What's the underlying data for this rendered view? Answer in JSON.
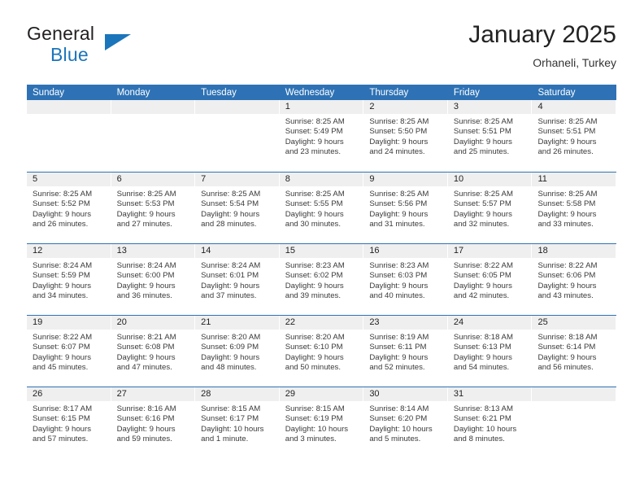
{
  "brand": {
    "name_top": "General",
    "name_bottom": "Blue",
    "logo_icon": "triangle-icon",
    "accent_color": "#1b75bb"
  },
  "header": {
    "title": "January 2025",
    "subtitle": "Orhaneli, Turkey"
  },
  "theme": {
    "header_bar_color": "#2e72b5",
    "day_band_color": "#efefef",
    "text_color": "#3a3a3a"
  },
  "calendar": {
    "weekdays": [
      "Sunday",
      "Monday",
      "Tuesday",
      "Wednesday",
      "Thursday",
      "Friday",
      "Saturday"
    ],
    "weeks": [
      [
        {
          "day": "",
          "lines": []
        },
        {
          "day": "",
          "lines": []
        },
        {
          "day": "",
          "lines": []
        },
        {
          "day": "1",
          "lines": [
            "Sunrise: 8:25 AM",
            "Sunset: 5:49 PM",
            "Daylight: 9 hours",
            "and 23 minutes."
          ]
        },
        {
          "day": "2",
          "lines": [
            "Sunrise: 8:25 AM",
            "Sunset: 5:50 PM",
            "Daylight: 9 hours",
            "and 24 minutes."
          ]
        },
        {
          "day": "3",
          "lines": [
            "Sunrise: 8:25 AM",
            "Sunset: 5:51 PM",
            "Daylight: 9 hours",
            "and 25 minutes."
          ]
        },
        {
          "day": "4",
          "lines": [
            "Sunrise: 8:25 AM",
            "Sunset: 5:51 PM",
            "Daylight: 9 hours",
            "and 26 minutes."
          ]
        }
      ],
      [
        {
          "day": "5",
          "lines": [
            "Sunrise: 8:25 AM",
            "Sunset: 5:52 PM",
            "Daylight: 9 hours",
            "and 26 minutes."
          ]
        },
        {
          "day": "6",
          "lines": [
            "Sunrise: 8:25 AM",
            "Sunset: 5:53 PM",
            "Daylight: 9 hours",
            "and 27 minutes."
          ]
        },
        {
          "day": "7",
          "lines": [
            "Sunrise: 8:25 AM",
            "Sunset: 5:54 PM",
            "Daylight: 9 hours",
            "and 28 minutes."
          ]
        },
        {
          "day": "8",
          "lines": [
            "Sunrise: 8:25 AM",
            "Sunset: 5:55 PM",
            "Daylight: 9 hours",
            "and 30 minutes."
          ]
        },
        {
          "day": "9",
          "lines": [
            "Sunrise: 8:25 AM",
            "Sunset: 5:56 PM",
            "Daylight: 9 hours",
            "and 31 minutes."
          ]
        },
        {
          "day": "10",
          "lines": [
            "Sunrise: 8:25 AM",
            "Sunset: 5:57 PM",
            "Daylight: 9 hours",
            "and 32 minutes."
          ]
        },
        {
          "day": "11",
          "lines": [
            "Sunrise: 8:25 AM",
            "Sunset: 5:58 PM",
            "Daylight: 9 hours",
            "and 33 minutes."
          ]
        }
      ],
      [
        {
          "day": "12",
          "lines": [
            "Sunrise: 8:24 AM",
            "Sunset: 5:59 PM",
            "Daylight: 9 hours",
            "and 34 minutes."
          ]
        },
        {
          "day": "13",
          "lines": [
            "Sunrise: 8:24 AM",
            "Sunset: 6:00 PM",
            "Daylight: 9 hours",
            "and 36 minutes."
          ]
        },
        {
          "day": "14",
          "lines": [
            "Sunrise: 8:24 AM",
            "Sunset: 6:01 PM",
            "Daylight: 9 hours",
            "and 37 minutes."
          ]
        },
        {
          "day": "15",
          "lines": [
            "Sunrise: 8:23 AM",
            "Sunset: 6:02 PM",
            "Daylight: 9 hours",
            "and 39 minutes."
          ]
        },
        {
          "day": "16",
          "lines": [
            "Sunrise: 8:23 AM",
            "Sunset: 6:03 PM",
            "Daylight: 9 hours",
            "and 40 minutes."
          ]
        },
        {
          "day": "17",
          "lines": [
            "Sunrise: 8:22 AM",
            "Sunset: 6:05 PM",
            "Daylight: 9 hours",
            "and 42 minutes."
          ]
        },
        {
          "day": "18",
          "lines": [
            "Sunrise: 8:22 AM",
            "Sunset: 6:06 PM",
            "Daylight: 9 hours",
            "and 43 minutes."
          ]
        }
      ],
      [
        {
          "day": "19",
          "lines": [
            "Sunrise: 8:22 AM",
            "Sunset: 6:07 PM",
            "Daylight: 9 hours",
            "and 45 minutes."
          ]
        },
        {
          "day": "20",
          "lines": [
            "Sunrise: 8:21 AM",
            "Sunset: 6:08 PM",
            "Daylight: 9 hours",
            "and 47 minutes."
          ]
        },
        {
          "day": "21",
          "lines": [
            "Sunrise: 8:20 AM",
            "Sunset: 6:09 PM",
            "Daylight: 9 hours",
            "and 48 minutes."
          ]
        },
        {
          "day": "22",
          "lines": [
            "Sunrise: 8:20 AM",
            "Sunset: 6:10 PM",
            "Daylight: 9 hours",
            "and 50 minutes."
          ]
        },
        {
          "day": "23",
          "lines": [
            "Sunrise: 8:19 AM",
            "Sunset: 6:11 PM",
            "Daylight: 9 hours",
            "and 52 minutes."
          ]
        },
        {
          "day": "24",
          "lines": [
            "Sunrise: 8:18 AM",
            "Sunset: 6:13 PM",
            "Daylight: 9 hours",
            "and 54 minutes."
          ]
        },
        {
          "day": "25",
          "lines": [
            "Sunrise: 8:18 AM",
            "Sunset: 6:14 PM",
            "Daylight: 9 hours",
            "and 56 minutes."
          ]
        }
      ],
      [
        {
          "day": "26",
          "lines": [
            "Sunrise: 8:17 AM",
            "Sunset: 6:15 PM",
            "Daylight: 9 hours",
            "and 57 minutes."
          ]
        },
        {
          "day": "27",
          "lines": [
            "Sunrise: 8:16 AM",
            "Sunset: 6:16 PM",
            "Daylight: 9 hours",
            "and 59 minutes."
          ]
        },
        {
          "day": "28",
          "lines": [
            "Sunrise: 8:15 AM",
            "Sunset: 6:17 PM",
            "Daylight: 10 hours",
            "and 1 minute."
          ]
        },
        {
          "day": "29",
          "lines": [
            "Sunrise: 8:15 AM",
            "Sunset: 6:19 PM",
            "Daylight: 10 hours",
            "and 3 minutes."
          ]
        },
        {
          "day": "30",
          "lines": [
            "Sunrise: 8:14 AM",
            "Sunset: 6:20 PM",
            "Daylight: 10 hours",
            "and 5 minutes."
          ]
        },
        {
          "day": "31",
          "lines": [
            "Sunrise: 8:13 AM",
            "Sunset: 6:21 PM",
            "Daylight: 10 hours",
            "and 8 minutes."
          ]
        },
        {
          "day": "",
          "lines": []
        }
      ]
    ]
  }
}
